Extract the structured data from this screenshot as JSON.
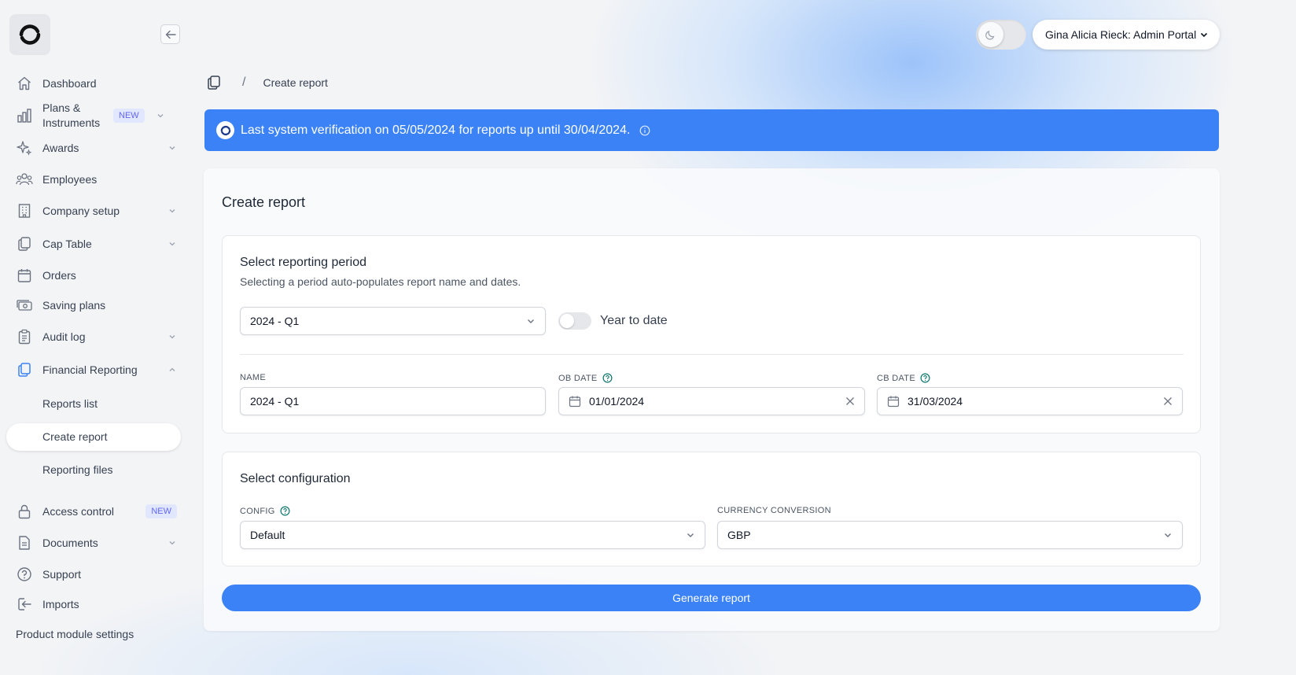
{
  "sidebar": {
    "items": [
      {
        "label": "Dashboard",
        "icon": "home-icon"
      },
      {
        "label": "Plans & Instruments",
        "icon": "bar-chart-icon",
        "badge": "NEW"
      },
      {
        "label": "Awards",
        "icon": "sparkles-icon"
      },
      {
        "label": "Employees",
        "icon": "users-icon"
      },
      {
        "label": "Company setup",
        "icon": "building-icon"
      },
      {
        "label": "Cap Table",
        "icon": "copy-icon"
      },
      {
        "label": "Orders",
        "icon": "calendar-icon"
      },
      {
        "label": "Saving plans",
        "icon": "cash-icon"
      },
      {
        "label": "Audit log",
        "icon": "clipboard-icon"
      },
      {
        "label": "Financial Reporting",
        "icon": "copy-icon"
      },
      {
        "label": "Access control",
        "icon": "lock-icon",
        "badge": "NEW"
      },
      {
        "label": "Documents",
        "icon": "document-icon"
      },
      {
        "label": "Support",
        "icon": "help-circle-icon"
      },
      {
        "label": "Imports",
        "icon": "import-icon"
      }
    ],
    "sub_items": [
      {
        "label": "Reports list"
      },
      {
        "label": "Create report"
      },
      {
        "label": "Reporting files"
      }
    ],
    "product_settings": "Product module settings"
  },
  "header": {
    "user_label": "Gina Alicia Rieck: Admin Portal"
  },
  "breadcrumb": {
    "separator": "/",
    "current": "Create report"
  },
  "banner": {
    "text": "Last system verification on 05/05/2024 for reports up until 30/04/2024."
  },
  "card": {
    "title": "Create report",
    "period": {
      "title": "Select reporting period",
      "subtitle": "Selecting a period auto-populates report name and dates.",
      "selected": "2024 - Q1",
      "toggle_label": "Year to date",
      "toggle_on": false
    },
    "fields": {
      "name_label": "NAME",
      "name_value": "2024 - Q1",
      "ob_label": "OB DATE",
      "ob_value": "01/01/2024",
      "cb_label": "CB DATE",
      "cb_value": "31/03/2024"
    },
    "config": {
      "title": "Select configuration",
      "config_label": "CONFIG",
      "config_value": "Default",
      "currency_label": "CURRENCY CONVERSION",
      "currency_value": "GBP"
    },
    "generate_label": "Generate report"
  },
  "colors": {
    "accent": "#3b82f6",
    "badge_bg": "#e0e7ff",
    "badge_text": "#6366f1"
  }
}
